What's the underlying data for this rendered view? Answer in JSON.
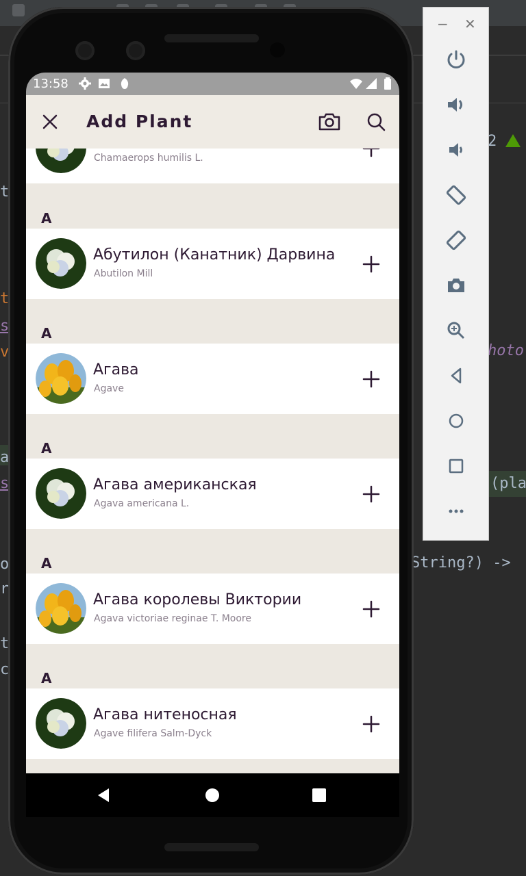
{
  "ide": {
    "code_lines": [
      "t",
      "t",
      "s",
      "v",
      "a",
      "s",
      "o",
      "r",
      "t",
      "c"
    ],
    "right_code": {
      "n2": "2",
      "photo": "hoto",
      "paren": "(pla",
      "signature": "String?) ->"
    }
  },
  "emulator_panel": {
    "minimize": "−",
    "close": "✕",
    "buttons": [
      {
        "icon": "power-icon"
      },
      {
        "icon": "volume-up-icon"
      },
      {
        "icon": "volume-down-icon"
      },
      {
        "icon": "rotate-left-icon"
      },
      {
        "icon": "rotate-right-icon"
      },
      {
        "icon": "camera-icon"
      },
      {
        "icon": "zoom-icon"
      },
      {
        "icon": "back-icon"
      },
      {
        "icon": "home-icon"
      },
      {
        "icon": "overview-icon"
      },
      {
        "icon": "more-icon"
      }
    ]
  },
  "status_bar": {
    "time": "13:58"
  },
  "app_bar": {
    "title": "Add Plant"
  },
  "list": {
    "partial_row": {
      "latin": "Chamaerops humilis L."
    },
    "sections": [
      {
        "letter": "A",
        "plant": {
          "name": "Абутилон (Канатник) Дарвина",
          "latin": "Abutilon Mill",
          "image": "hydrangea"
        }
      },
      {
        "letter": "A",
        "plant": {
          "name": "Агава",
          "latin": "Agave",
          "image": "tulips"
        }
      },
      {
        "letter": "A",
        "plant": {
          "name": "Агава американская",
          "latin": "Agava americana L.",
          "image": "hydrangea"
        }
      },
      {
        "letter": "A",
        "plant": {
          "name": "Агава королевы Виктории",
          "latin": "Agava  victoriae reginae T. Moore",
          "image": "tulips"
        }
      },
      {
        "letter": "A",
        "plant": {
          "name": "Агава нитеносная",
          "latin": "Agave filifera Salm-Dyck",
          "image": "hydrangea"
        }
      }
    ]
  },
  "colors": {
    "app_bar_bg": "#efebe4",
    "section_bg": "#ece8e1",
    "text_primary": "#2e1a33",
    "text_secondary": "#8a7f8c"
  }
}
